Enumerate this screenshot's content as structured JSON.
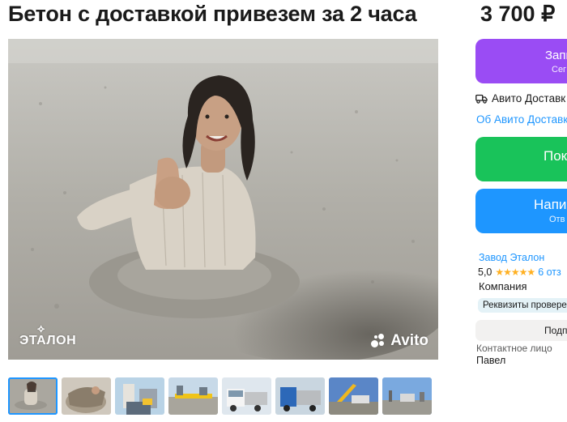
{
  "listing": {
    "title": "Бетон с доставкой привезем за 2 часа",
    "price": "3 700 ₽"
  },
  "photo": {
    "watermark_left": "ЭТАЛОН",
    "watermark_right": "Avito",
    "thumbnail_count": 8,
    "active_thumbnail": 1
  },
  "sidebar": {
    "book_button_label": "Запи",
    "book_button_sub": "Сег",
    "delivery_text": "Авито Доставк",
    "delivery_link": "Об Авито Доставк",
    "show_phone_label": "Пок",
    "write_button_label": "Напи",
    "write_button_sub": "Отв"
  },
  "seller": {
    "name": "Завод Эталон",
    "rating": "5,0",
    "stars": "★★★★★",
    "reviews": "6 отз",
    "type": "Компания",
    "badge": "Реквизиты провере",
    "subscribe_label": "Подп",
    "contact_label": "Контактное лицо",
    "contact_name": "Павел"
  },
  "colors": {
    "book": "#9a4cf4",
    "show": "#19c35a",
    "write": "#1e96ff",
    "link": "#1e96ff",
    "star": "#ffb021"
  }
}
